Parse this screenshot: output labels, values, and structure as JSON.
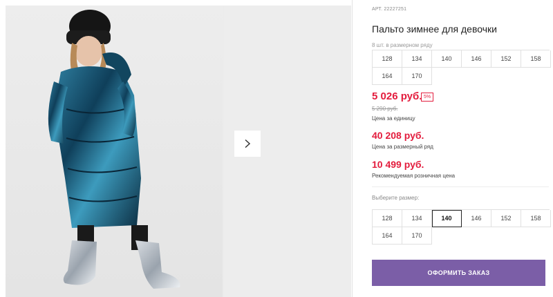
{
  "product": {
    "sku": "АРТ. 22227251",
    "title": "Пальто зимнее для девочки",
    "sizes_note": "8 шт. в размерном ряду",
    "sizes_range": [
      "128",
      "134",
      "140",
      "146",
      "152",
      "158",
      "164",
      "170"
    ]
  },
  "pricing": {
    "price": "5 026 руб.",
    "discount": "5%",
    "old_price": "5 290 руб.",
    "price_label": "Цена за единицу",
    "set_price": "40 208 руб.",
    "set_price_label": "Цена за размерный ряд",
    "retail_price": "10 499 руб.",
    "retail_price_label": "Рекомендуемая розничная цена"
  },
  "size_picker": {
    "label": "Выберите размер:",
    "options": [
      "128",
      "134",
      "140",
      "146",
      "152",
      "158",
      "164",
      "170"
    ],
    "selected": "140"
  },
  "actions": {
    "order_label": "ОФОРМИТЬ ЗАКАЗ"
  },
  "icons": {
    "next": "chevron-right-icon"
  },
  "colors": {
    "accent": "#7b5ea7",
    "price": "#e31c3d"
  }
}
